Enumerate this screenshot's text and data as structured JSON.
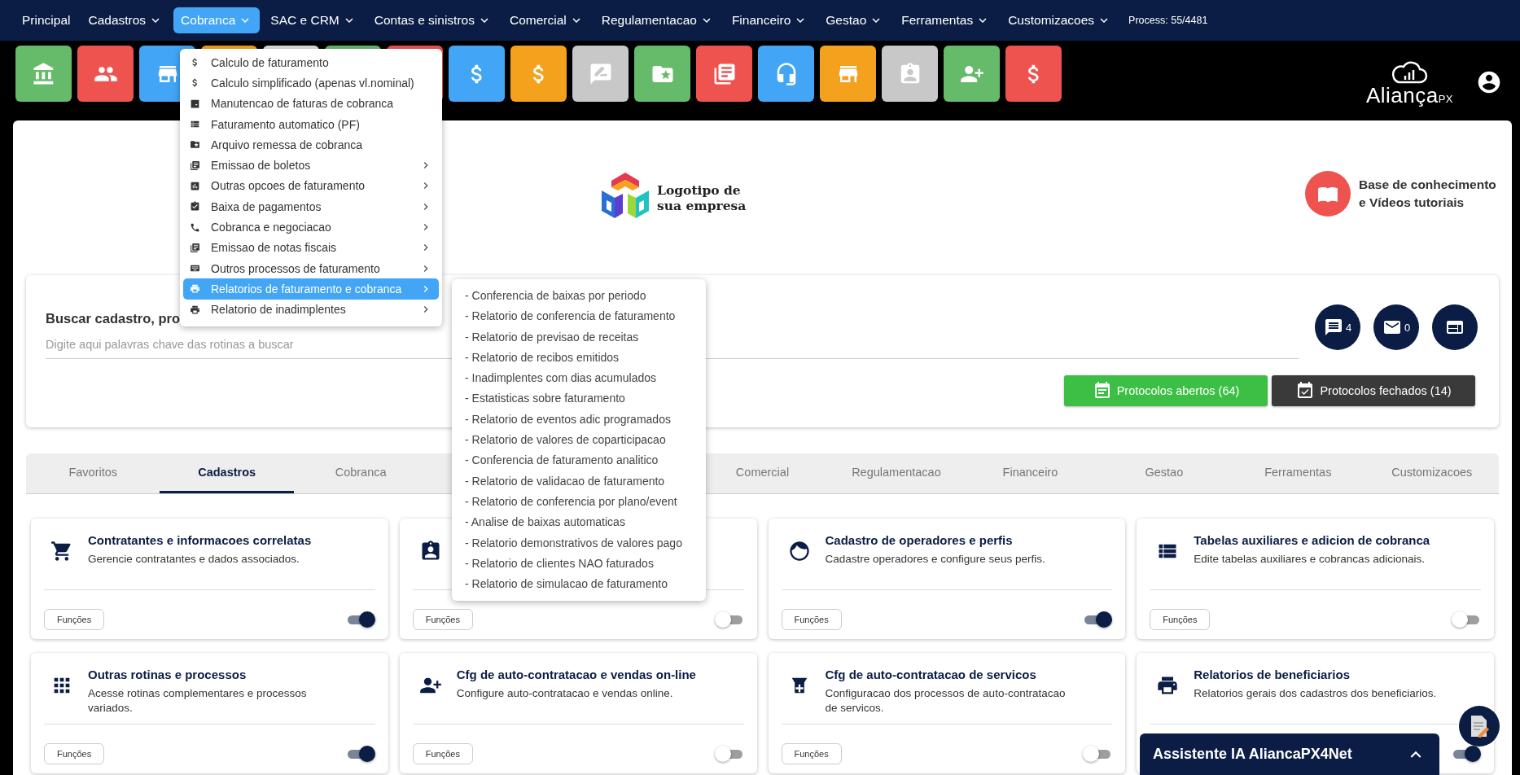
{
  "nav": {
    "items": [
      {
        "label": "Principal",
        "has_menu": false,
        "selected": false
      },
      {
        "label": "Cadastros",
        "has_menu": true,
        "selected": false
      },
      {
        "label": "Cobranca",
        "has_menu": true,
        "selected": true
      },
      {
        "label": "SAC e CRM",
        "has_menu": true,
        "selected": false
      },
      {
        "label": "Contas e sinistros",
        "has_menu": true,
        "selected": false
      },
      {
        "label": "Comercial",
        "has_menu": true,
        "selected": false
      },
      {
        "label": "Regulamentacao",
        "has_menu": true,
        "selected": false
      },
      {
        "label": "Financeiro",
        "has_menu": true,
        "selected": false
      },
      {
        "label": "Gestao",
        "has_menu": true,
        "selected": false
      },
      {
        "label": "Ferramentas",
        "has_menu": true,
        "selected": false
      },
      {
        "label": "Customizacoes",
        "has_menu": true,
        "selected": false
      }
    ],
    "process": "Process: 55/4481"
  },
  "toolbar": {
    "tiles": [
      {
        "color": "#66bb6a"
      },
      {
        "color": "#ef5350"
      },
      {
        "color": "#42a5f5"
      },
      {
        "color": "#f4a21d"
      },
      {
        "color": "#e0e0e0"
      },
      {
        "color": "#66bb6a"
      },
      {
        "color": "#ef5350"
      },
      {
        "color": "#42a5f5"
      },
      {
        "color": "#f4a21d"
      },
      {
        "color": "#c8c8c8"
      },
      {
        "color": "#66bb6a"
      },
      {
        "color": "#ef5350"
      },
      {
        "color": "#42a5f5"
      },
      {
        "color": "#f4a21d"
      },
      {
        "color": "#c8c8c8"
      },
      {
        "color": "#66bb6a"
      },
      {
        "color": "#ef5350"
      }
    ],
    "brand": {
      "name": "Aliança",
      "mark": "PX"
    }
  },
  "header": {
    "logo_text": "Logotipo de sua empresa",
    "help": "Base de conhecimento e Vídeos tutoriais"
  },
  "search": {
    "title": "Buscar cadastro, pro",
    "placeholder": "Digite aqui palavras chave das rotinas a buscar",
    "badges": [
      {
        "kind": "chat",
        "count": "4"
      },
      {
        "kind": "mail",
        "count": "0"
      },
      {
        "kind": "panel"
      }
    ],
    "buttons": [
      {
        "kind": "open",
        "label": "Protocolos abertos (64)"
      },
      {
        "kind": "closed",
        "label": "Protocolos fechados (14)"
      }
    ]
  },
  "tabs": [
    {
      "label": "Favoritos",
      "selected": false
    },
    {
      "label": "Cadastros",
      "selected": true
    },
    {
      "label": "Cobranca",
      "selected": false
    },
    {
      "label": "Comercial",
      "selected": false
    },
    {
      "label": "Regulamentacao",
      "selected": false
    },
    {
      "label": "Financeiro",
      "selected": false
    },
    {
      "label": "Gestao",
      "selected": false
    },
    {
      "label": "Ferramentas",
      "selected": false
    },
    {
      "label": "Customizacoes",
      "selected": false
    }
  ],
  "cards": [
    {
      "title": "Contratantes e informacoes correlatas",
      "description": "Gerencie contratantes e dados associados.",
      "button": "Funções",
      "on": true
    },
    {
      "button": "Funções",
      "on": false
    },
    {
      "title": "Cadastro de operadores e perfis",
      "description": "Cadastre operadores e configure seus perfis.",
      "button": "Funções",
      "on": true
    },
    {
      "title": "Tabelas auxiliares e adicion de cobranca",
      "description": "Edite tabelas auxiliares e cobrancas adicionais.",
      "button": "Funções",
      "on": false
    },
    {
      "title": "Outras rotinas e processos",
      "description": "Acesse rotinas complementares e processos variados.",
      "button": "Funções",
      "on": true
    },
    {
      "title": "Cfg de auto-contratacao e vendas on-line",
      "description": "Configure auto-contratacao e vendas online.",
      "button": "Funções",
      "on": false
    },
    {
      "title": "Cfg de auto-contratacao de servicos",
      "description": "Configuracao dos processos de auto-contratacao de servicos.",
      "button": "Funções",
      "on": false
    },
    {
      "title": "Relatorios de beneficiarios",
      "description": "Relatorios gerais dos cadastros dos beneficiarios.",
      "on": true
    }
  ],
  "menu": {
    "items": [
      {
        "label": "Calculo de faturamento",
        "has_submenu": false,
        "selected": false
      },
      {
        "label": "Calculo simplificado (apenas vl.nominal)",
        "has_submenu": false,
        "selected": false
      },
      {
        "label": "Manutencao de faturas de cobranca",
        "has_submenu": false,
        "selected": false
      },
      {
        "label": "Faturamento automatico (PF)",
        "has_submenu": false,
        "selected": false
      },
      {
        "label": "Arquivo remessa de cobranca",
        "has_submenu": false,
        "selected": false
      },
      {
        "label": "Emissao de boletos",
        "has_submenu": true,
        "selected": false
      },
      {
        "label": "Outras opcoes de faturamento",
        "has_submenu": true,
        "selected": false
      },
      {
        "label": "Baixa de pagamentos",
        "has_submenu": true,
        "selected": false
      },
      {
        "label": "Cobranca e negociacao",
        "has_submenu": true,
        "selected": false
      },
      {
        "label": "Emissao de notas fiscais",
        "has_submenu": true,
        "selected": false
      },
      {
        "label": "Outros processos de faturamento",
        "has_submenu": true,
        "selected": false
      },
      {
        "label": "Relatorios de faturamento e cobranca",
        "has_submenu": true,
        "selected": true
      },
      {
        "label": "Relatorio de inadimplentes",
        "has_submenu": true,
        "selected": false
      }
    ]
  },
  "submenu": {
    "items": [
      "- Conferencia de baixas por periodo",
      "- Relatorio de conferencia de faturamento",
      "- Relatorio de previsao de receitas",
      "- Relatorio de recibos emitidos",
      "- Inadimplentes com dias acumulados",
      "- Estatisticas sobre faturamento",
      "- Relatorio de eventos adic programados",
      "- Relatorio de valores de coparticipacao",
      "- Conferencia de faturamento analitico",
      "- Relatorio de validacao de faturamento",
      "- Relatorio de conferencia por plano/event",
      "- Analise de baixas automaticas",
      "- Relatorio demonstrativos de valores pago",
      "- Relatorio de clientes NAO faturados",
      "- Relatorio de simulacao de faturamento"
    ]
  },
  "assistant": {
    "title": "Assistente IA AliancaPX4Net",
    "expanded": false
  }
}
